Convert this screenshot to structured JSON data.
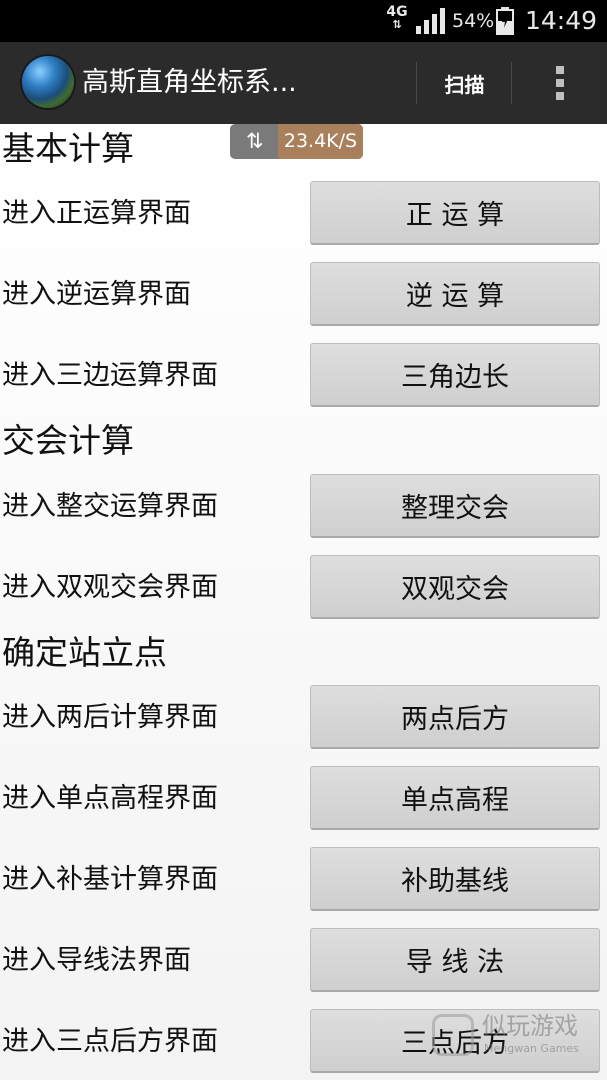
{
  "status_bar": {
    "network": "4G",
    "battery_percent": "54%",
    "time": "14:49"
  },
  "action_bar": {
    "title": "高斯直角坐标系...",
    "scan_label": "扫描",
    "icons": [
      "app-globe-icon",
      "overflow-menu-icon"
    ]
  },
  "speed_overlay": {
    "value": "23.4K/S"
  },
  "sections": [
    {
      "header": "基本计算",
      "rows": [
        {
          "label": "进入正运算界面",
          "button": "正 运 算"
        },
        {
          "label": "进入逆运算界面",
          "button": "逆 运 算"
        },
        {
          "label": "进入三边运算界面",
          "button": "三角边长"
        }
      ]
    },
    {
      "header": "交会计算",
      "rows": [
        {
          "label": "进入整交运算界面",
          "button": "整理交会"
        },
        {
          "label": "进入双观交会界面",
          "button": "双观交会"
        }
      ]
    },
    {
      "header": "确定站立点",
      "rows": [
        {
          "label": "进入两后计算界面",
          "button": "两点后方"
        },
        {
          "label": "进入单点高程界面",
          "button": "单点高程"
        },
        {
          "label": "进入补基计算界面",
          "button": "补助基线"
        },
        {
          "label": "进入导线法界面",
          "button": "导 线 法"
        },
        {
          "label": "进入三点后方界面",
          "button": "三点后方"
        }
      ]
    }
  ],
  "watermark": {
    "cn": "似玩游戏",
    "en": "Mengwan Games"
  }
}
